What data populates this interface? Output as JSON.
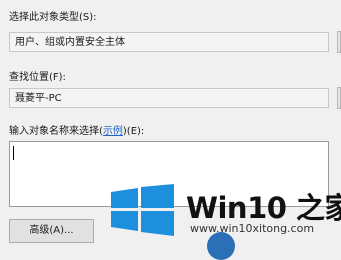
{
  "object_type": {
    "label": "选择此对象类型(S):",
    "value": "用户、组或内置安全主体"
  },
  "location": {
    "label": "查找位置(F):",
    "value": "聂菱平-PC"
  },
  "names": {
    "label_prefix": "输入对象名称来选择(",
    "label_link": "示例",
    "label_suffix": ")(E):",
    "value": ""
  },
  "advanced_button": {
    "label": "高级(A)..."
  },
  "watermark": {
    "title": "Win10 之家",
    "url": "www.win10xitong.com",
    "colors": {
      "logo": "#1e8fdc",
      "title": "#111111"
    }
  }
}
